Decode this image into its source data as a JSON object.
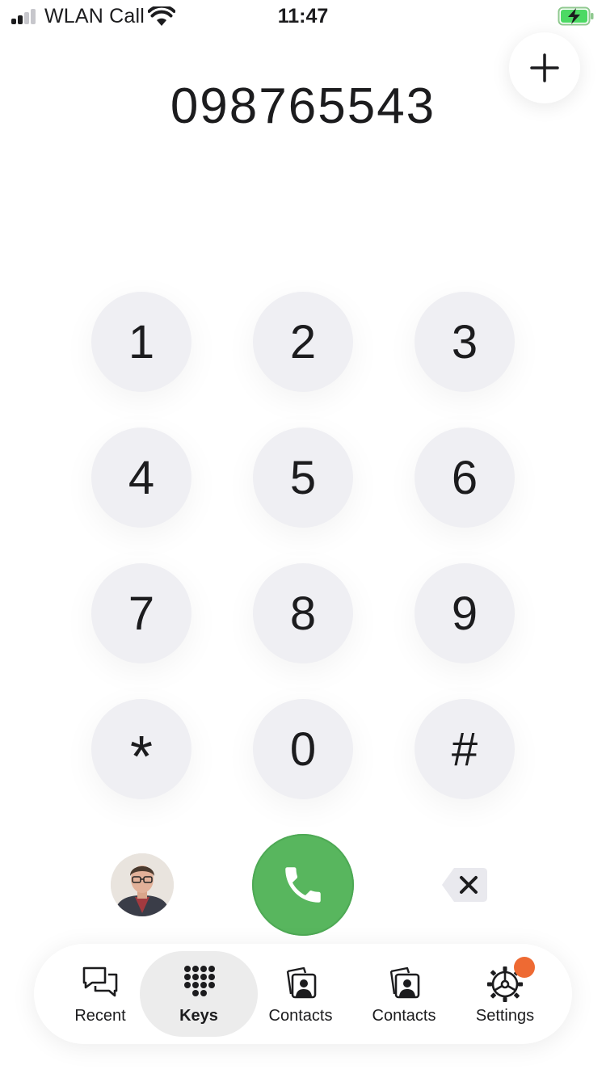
{
  "status_bar": {
    "carrier": "WLAN Call",
    "time": "11:47",
    "battery_color": "#4cd964"
  },
  "dialer": {
    "number": "098765543",
    "keys": [
      "1",
      "2",
      "3",
      "4",
      "5",
      "6",
      "7",
      "8",
      "9",
      "*",
      "0",
      "#"
    ]
  },
  "colors": {
    "call_green": "#58b65e",
    "key_bg": "#efeff3",
    "badge": "#ee6a33"
  },
  "icons": {
    "add": "plus-icon",
    "call": "phone-icon",
    "backspace": "backspace-icon",
    "recent": "chat-bubbles-icon",
    "keys": "keypad-icon",
    "contacts": "contact-card-icon",
    "settings": "gear-icon"
  },
  "tab_bar": {
    "tabs": [
      {
        "label": "Recent"
      },
      {
        "label": "Keys"
      },
      {
        "label": "Contacts"
      },
      {
        "label": "Contacts"
      },
      {
        "label": "Settings"
      }
    ],
    "active_index": 1
  }
}
